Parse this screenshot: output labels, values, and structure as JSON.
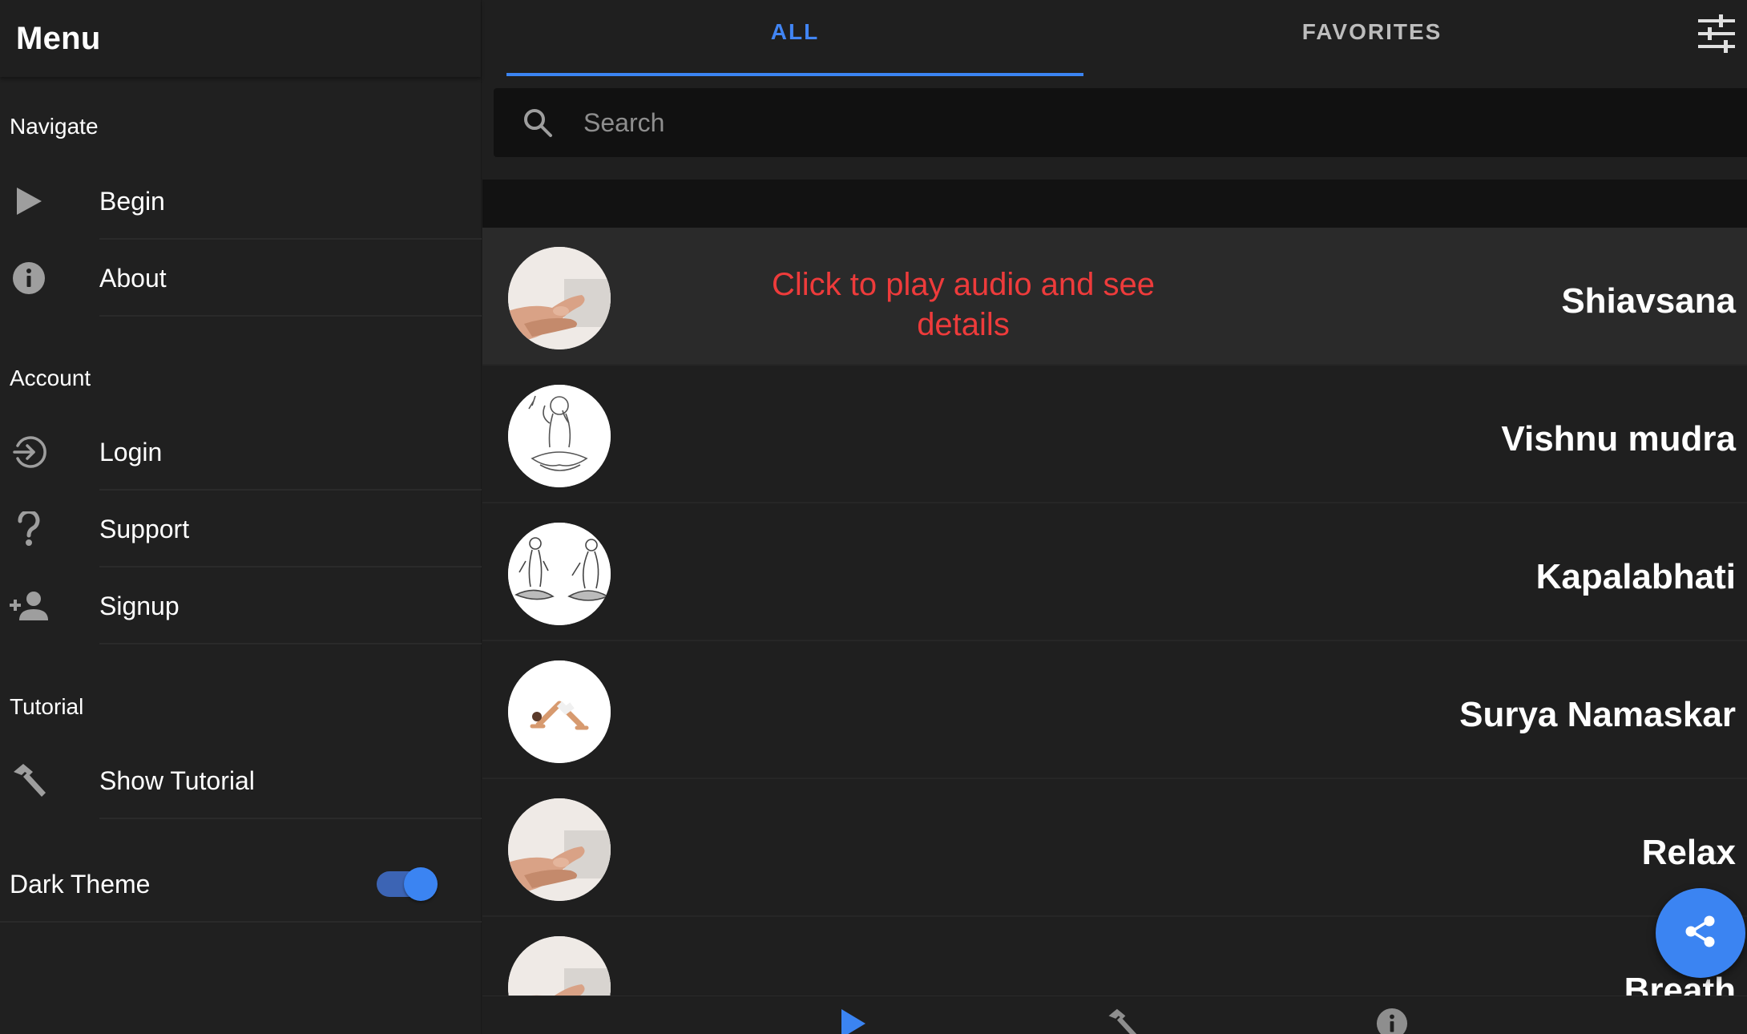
{
  "sidebar": {
    "title": "Menu",
    "sections": {
      "navigate": "Navigate",
      "account": "Account",
      "tutorial": "Tutorial"
    },
    "items": {
      "begin": {
        "label": "Begin",
        "icon": "play-icon"
      },
      "about": {
        "label": "About",
        "icon": "info-icon"
      },
      "login": {
        "label": "Login",
        "icon": "login-icon"
      },
      "support": {
        "label": "Support",
        "icon": "help-icon"
      },
      "signup": {
        "label": "Signup",
        "icon": "add-person-icon"
      },
      "show_tutorial": {
        "label": "Show Tutorial",
        "icon": "hammer-icon"
      }
    },
    "dark_theme": {
      "label": "Dark Theme",
      "enabled": true
    }
  },
  "tabs": {
    "all": "ALL",
    "favorites": "FAVORITES",
    "active": "all"
  },
  "search": {
    "placeholder": "Search",
    "value": ""
  },
  "tutorial_hint": "Click to play audio and see details",
  "list": {
    "items": [
      {
        "title": "Shiavsana",
        "thumbnail": "hands-mudra",
        "selected": true
      },
      {
        "title": "Vishnu mudra",
        "thumbnail": "seated-sketch"
      },
      {
        "title": "Kapalabhati",
        "thumbnail": "two-seated-figures"
      },
      {
        "title": "Surya Namaskar",
        "thumbnail": "downward-dog"
      },
      {
        "title": "Relax",
        "thumbnail": "hands-mudra"
      },
      {
        "title": "Breath",
        "thumbnail": "hands-mudra"
      }
    ]
  },
  "fab": {
    "icon": "share-icon"
  },
  "bottom_bar": {
    "icons": [
      "play-icon",
      "hammer-icon",
      "info-icon"
    ]
  },
  "colors": {
    "accent": "#3b84f2",
    "background": "#1f1f1f",
    "hint": "#ee3b3b"
  }
}
